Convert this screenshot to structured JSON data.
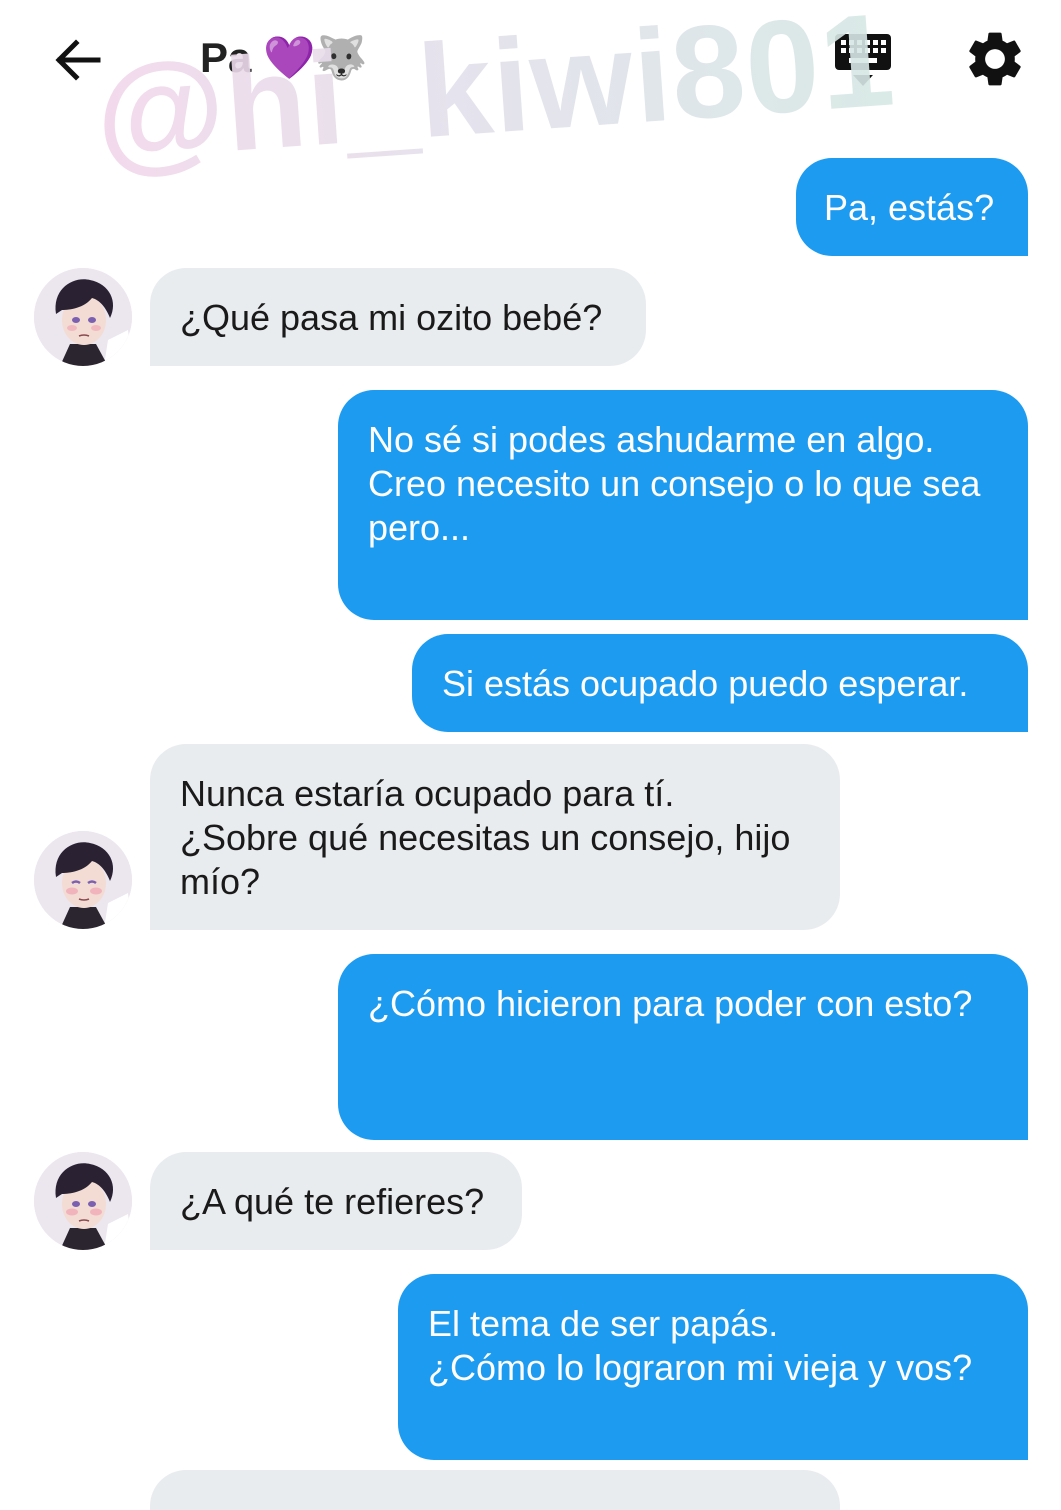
{
  "header": {
    "title": "Pa",
    "title_emoji": "💜🐺",
    "back_icon": "arrow-left-icon",
    "keyboard_icon": "keyboard-hide-icon",
    "settings_icon": "gear-icon"
  },
  "watermark": "@hi_kiwi801",
  "colors": {
    "outgoing_bubble": "#1d9bf0",
    "incoming_bubble": "#e9ecef",
    "outgoing_text": "#ffffff",
    "incoming_text": "#1a1a1a"
  },
  "messages": [
    {
      "sender": "me",
      "text": "Pa, estás?"
    },
    {
      "sender": "pa",
      "text": "¿Qué pasa mi ozito bebé?"
    },
    {
      "sender": "me",
      "text": "No sé si podes ashudarme en algo.\nCreo necesito un consejo o lo que sea pero..."
    },
    {
      "sender": "me",
      "text": "Si estás ocupado puedo esperar."
    },
    {
      "sender": "pa",
      "text": "Nunca estaría ocupado para tí.\n¿Sobre qué necesitas un consejo, hijo mío?"
    },
    {
      "sender": "me",
      "text": "¿Cómo hicieron para poder con esto?"
    },
    {
      "sender": "pa",
      "text": "¿A qué te refieres?"
    },
    {
      "sender": "me",
      "text": "El tema de ser papás.\n¿Cómo lo lograron mi vieja y vos?"
    }
  ]
}
